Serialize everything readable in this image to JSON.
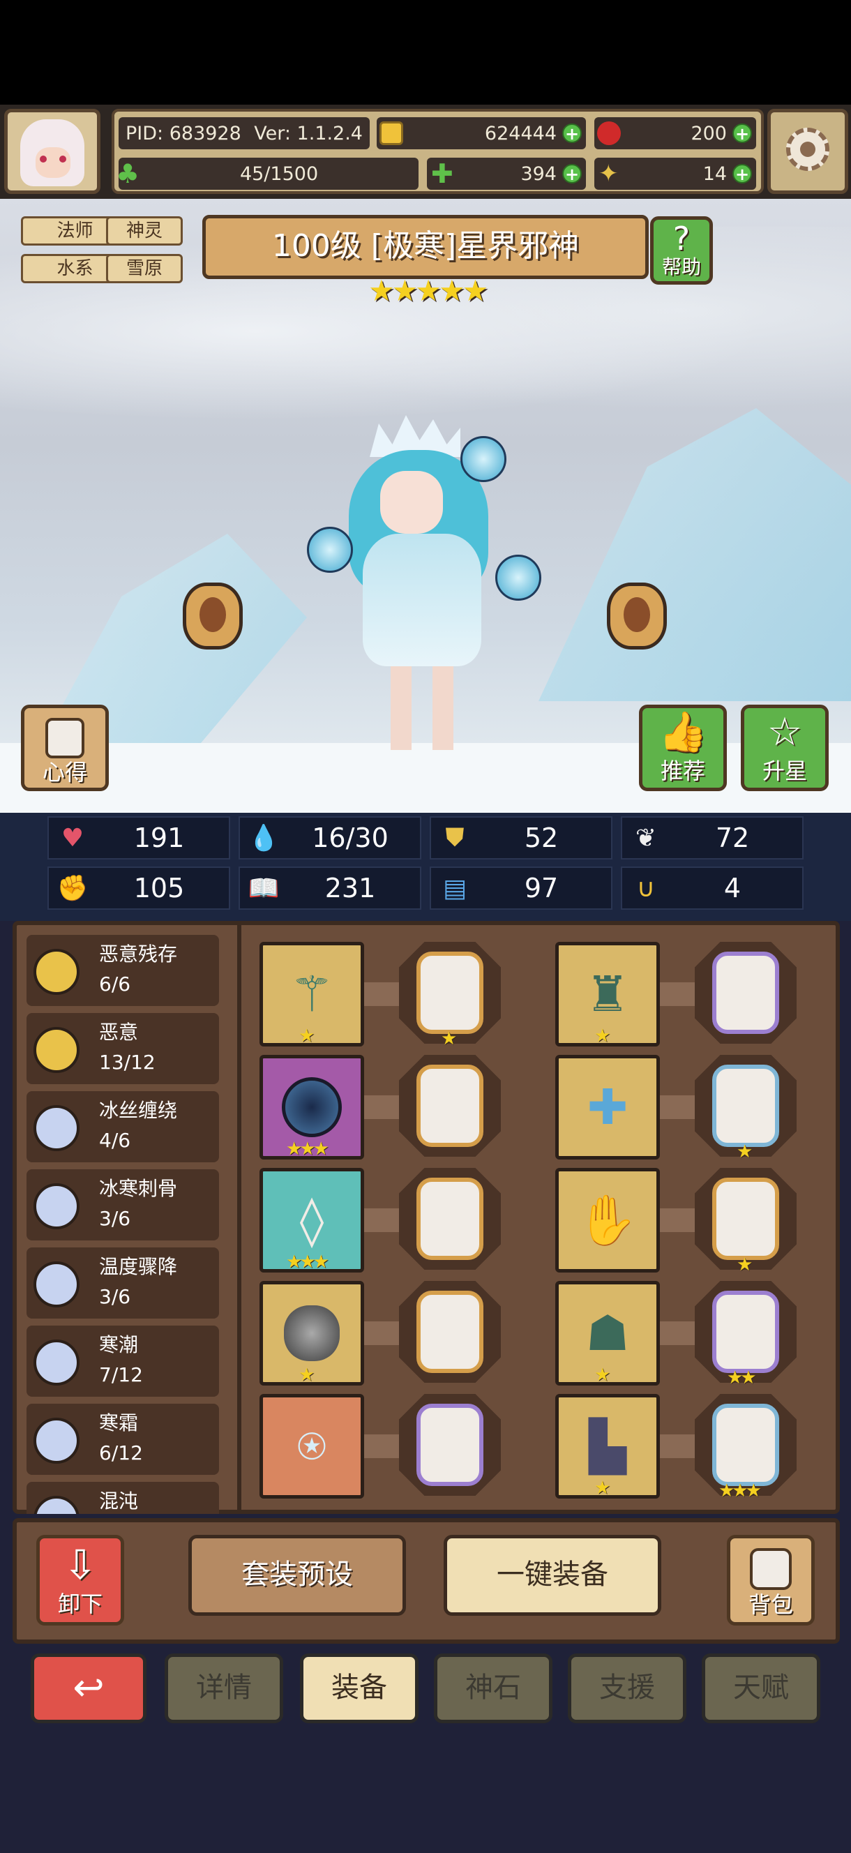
{
  "header": {
    "pid": "PID: 683928",
    "version": "Ver: 1.1.2.4",
    "gold": "624444",
    "gems": "200",
    "exp": "45/1500",
    "clover": "394",
    "tickets": "14"
  },
  "tags": [
    "法师",
    "神灵",
    "水系",
    "雪原"
  ],
  "hero": {
    "title": "100级 [极寒]星界邪神",
    "stars": "★★★★★",
    "help_label": "帮助",
    "xinde_label": "心得",
    "tuijian_label": "推荐",
    "shengxing_label": "升星"
  },
  "stats": {
    "hp": "191",
    "mana": "16/30",
    "armor": "52",
    "speed": "72",
    "attack": "105",
    "magic": "231",
    "crit": "97",
    "luck": "4"
  },
  "sets": [
    {
      "name": "恶意残存",
      "count": "6/6"
    },
    {
      "name": "恶意",
      "count": "13/12"
    },
    {
      "name": "冰丝缠绕",
      "count": "4/6"
    },
    {
      "name": "冰寒刺骨",
      "count": "3/6"
    },
    {
      "name": "温度骤降",
      "count": "3/6"
    },
    {
      "name": "寒潮",
      "count": "7/12"
    },
    {
      "name": "寒霜",
      "count": "6/12"
    },
    {
      "name": "混沌",
      "count": ""
    }
  ],
  "equipment": {
    "row1": {
      "left_stars": "★",
      "left_rune_stars": "★",
      "right_stars": "★",
      "right_rune_stars": ""
    },
    "row2": {
      "left_stars": "★★★",
      "left_rune_stars": "",
      "right_stars": "",
      "right_rune_stars": "★"
    },
    "row3": {
      "left_stars": "★★★",
      "left_rune_stars": "",
      "right_stars": "",
      "right_rune_stars": "★"
    },
    "row4": {
      "left_stars": "★",
      "left_rune_stars": "",
      "right_stars": "★",
      "right_rune_stars": "★★"
    },
    "row5": {
      "left_stars": "",
      "left_rune_stars": "",
      "right_stars": "★",
      "right_rune_stars": "★★★"
    }
  },
  "actions": {
    "unequip": "卸下",
    "preset": "套装预设",
    "auto_equip": "一键装备",
    "bag": "背包"
  },
  "tabs": [
    "详情",
    "装备",
    "神石",
    "支援",
    "天赋"
  ],
  "colors": {
    "active_tab": "#f0dfb4",
    "inactive_tab": "#6b6650",
    "back_button": "#e0524a",
    "rune_gold": "#d59e4a",
    "rune_purple": "#9c7fd0",
    "rune_blue": "#7fb6d6"
  }
}
